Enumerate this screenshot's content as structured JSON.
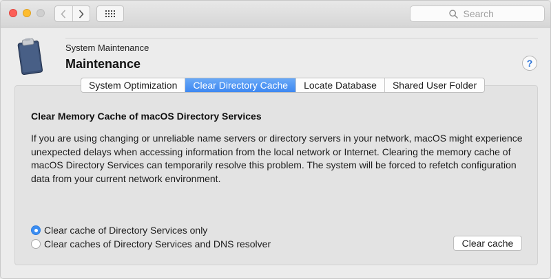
{
  "toolbar": {
    "search_placeholder": "Search",
    "icons": {
      "back": "chevron-left-icon",
      "forward": "chevron-right-icon",
      "show_all": "grid-icon",
      "search": "search-icon"
    }
  },
  "header": {
    "subtitle": "System Maintenance",
    "title": "Maintenance",
    "help_label": "?",
    "icon": "clipboard-icon"
  },
  "tabs": [
    {
      "label": "System Optimization",
      "active": false
    },
    {
      "label": "Clear Directory Cache",
      "active": true
    },
    {
      "label": "Locate Database",
      "active": false
    },
    {
      "label": "Shared User Folder",
      "active": false
    }
  ],
  "content": {
    "section_title": "Clear Memory Cache of macOS Directory Services",
    "description": "If you are using changing or unreliable name servers or directory servers in your network, macOS might experience unexpected delays when accessing information from the local network or Internet. Clearing the memory cache of macOS Directory Services can temporarily resolve this problem. The system will be forced to refetch configuration data from your current network environment.",
    "options": [
      {
        "label": "Clear cache of Directory Services only",
        "checked": true
      },
      {
        "label": "Clear caches of Directory Services and DNS resolver",
        "checked": false
      }
    ],
    "action_button": "Clear cache"
  },
  "colors": {
    "accent": "#3e88f1",
    "help_blue": "#2a73d8"
  }
}
